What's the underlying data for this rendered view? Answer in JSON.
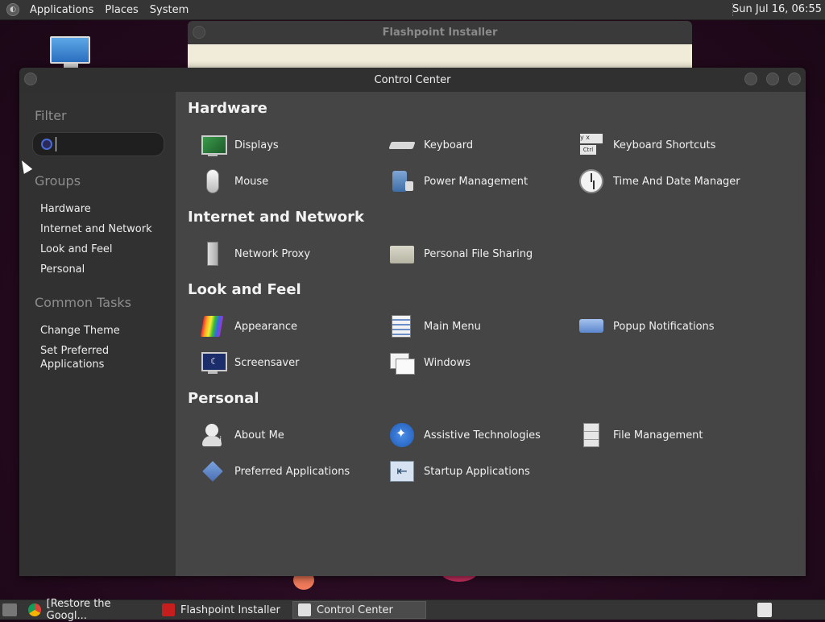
{
  "top_panel": {
    "menus": [
      "Applications",
      "Places",
      "System"
    ],
    "clock": "Sun Jul 16, 06:55"
  },
  "background_window": {
    "title": "Flashpoint Installer"
  },
  "control_center": {
    "title": "Control Center",
    "sidebar": {
      "filter_heading": "Filter",
      "search_placeholder": "",
      "search_value": "",
      "groups_heading": "Groups",
      "groups": [
        "Hardware",
        "Internet and Network",
        "Look and Feel",
        "Personal"
      ],
      "tasks_heading": "Common Tasks",
      "tasks": [
        "Change Theme",
        "Set Preferred\nApplications"
      ]
    },
    "sections": [
      {
        "title": "Hardware",
        "items": [
          {
            "label": "Displays",
            "icon": "displays-icon"
          },
          {
            "label": "Keyboard",
            "icon": "keyboard-icon"
          },
          {
            "label": "Keyboard Shortcuts",
            "icon": "keyboard-shortcuts-icon"
          },
          {
            "label": "Mouse",
            "icon": "mouse-icon"
          },
          {
            "label": "Power Management",
            "icon": "power-management-icon"
          },
          {
            "label": "Time And Date Manager",
            "icon": "clock-icon"
          }
        ]
      },
      {
        "title": "Internet and Network",
        "items": [
          {
            "label": "Network Proxy",
            "icon": "network-proxy-icon"
          },
          {
            "label": "Personal File Sharing",
            "icon": "folder-share-icon"
          }
        ]
      },
      {
        "title": "Look and Feel",
        "items": [
          {
            "label": "Appearance",
            "icon": "appearance-icon"
          },
          {
            "label": "Main Menu",
            "icon": "main-menu-icon"
          },
          {
            "label": "Popup Notifications",
            "icon": "popup-notification-icon"
          },
          {
            "label": "Screensaver",
            "icon": "screensaver-icon"
          },
          {
            "label": "Windows",
            "icon": "windows-icon"
          }
        ]
      },
      {
        "title": "Personal",
        "items": [
          {
            "label": "About Me",
            "icon": "about-me-icon"
          },
          {
            "label": "Assistive Technologies",
            "icon": "accessibility-icon"
          },
          {
            "label": "File Management",
            "icon": "file-cabinet-icon"
          },
          {
            "label": "Preferred Applications",
            "icon": "preferred-apps-icon"
          },
          {
            "label": "Startup Applications",
            "icon": "startup-apps-icon"
          }
        ]
      }
    ]
  },
  "taskbar": {
    "tasks": [
      {
        "label": "[Restore the Googl...",
        "icon": "chrome-icon",
        "active": false
      },
      {
        "label": "Flashpoint Installer",
        "icon": "flashpoint-icon",
        "active": false
      },
      {
        "label": "Control Center",
        "icon": "control-center-icon",
        "active": true
      }
    ]
  }
}
